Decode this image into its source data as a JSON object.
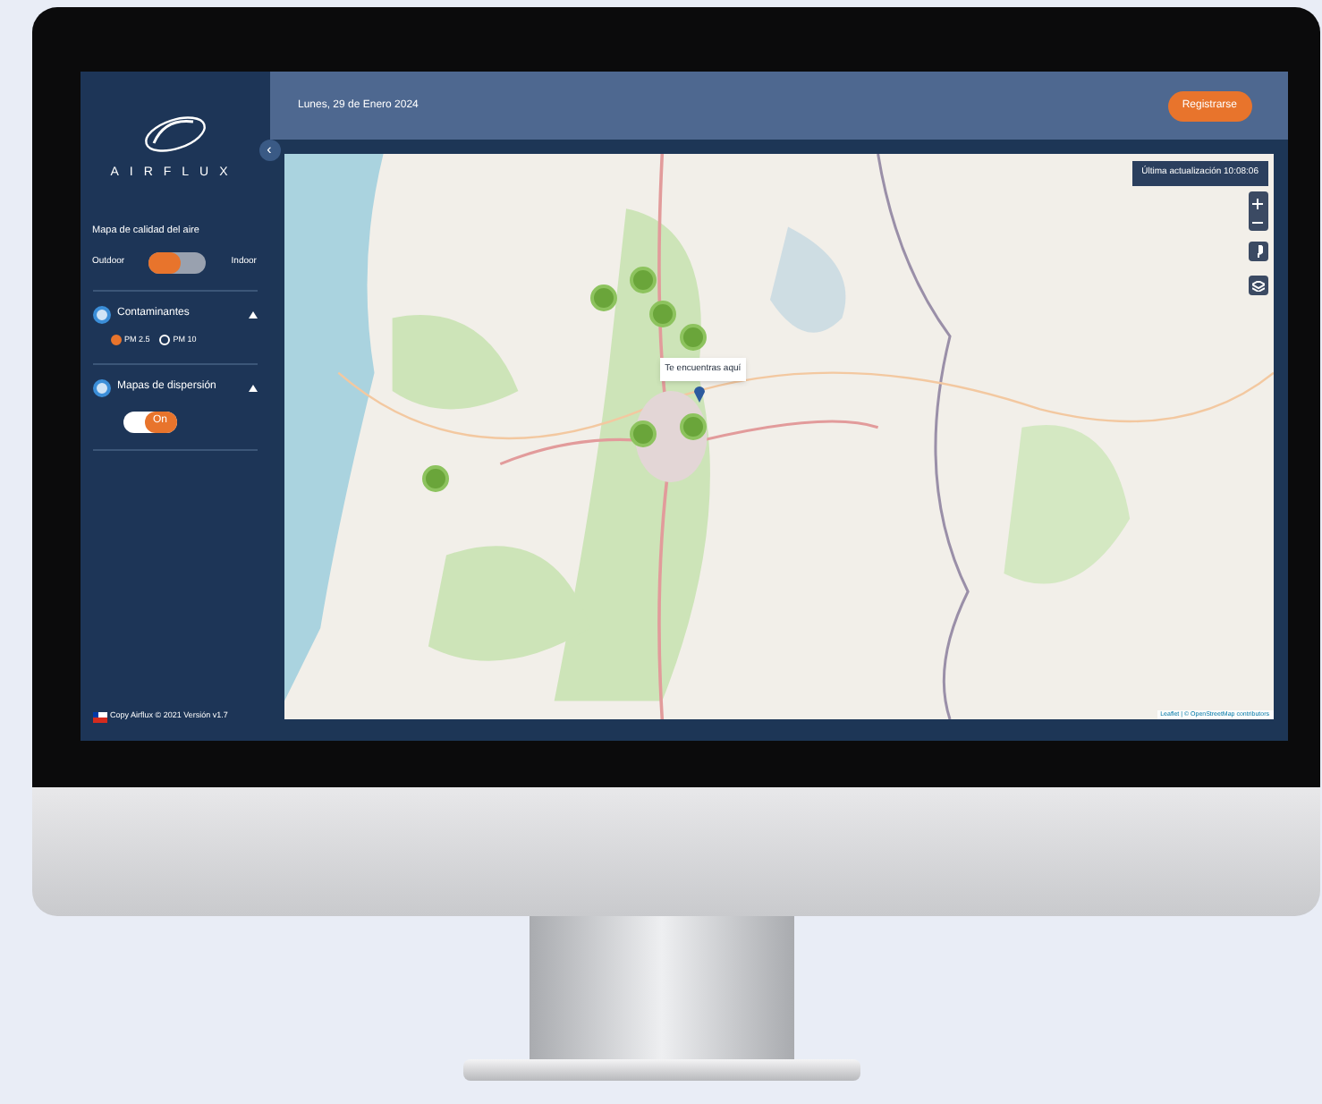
{
  "sidebar": {
    "logo_text": "AIRFLUX",
    "collapse_icon": "‹",
    "map_title": "Mapa de calidad del aire",
    "mode_toggle": {
      "left_label": "Outdoor",
      "right_label": "Indoor",
      "outdoor_selected": true
    },
    "sections": [
      {
        "title": "Contaminantes",
        "expanded": true,
        "kind": "radios",
        "options": [
          {
            "label": "PM 2.5",
            "selected": true
          },
          {
            "label": "PM 10",
            "selected": false
          }
        ]
      },
      {
        "title": "Mapas de dispersión",
        "expanded": true,
        "kind": "toggle",
        "toggle": {
          "label": "On",
          "on": true
        }
      }
    ],
    "footer": "Copy Airflux © 2021 Versión v1.7"
  },
  "header": {
    "date": "Lunes, 29 de Enero 2024",
    "button": "Registrarse"
  },
  "map": {
    "last_update": "Última actualización 10:08:06",
    "popup": "Te encuentras aquí",
    "attribution": "Leaflet | © OpenStreetMap contributors"
  }
}
